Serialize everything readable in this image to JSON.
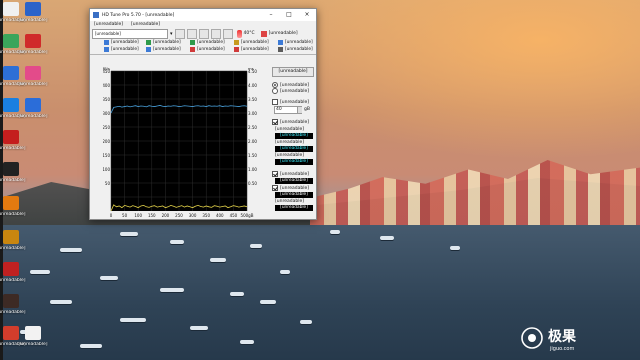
{
  "desktop": {
    "icons": [
      {
        "label": "[unreadable]",
        "color": "#f0f0f0"
      },
      {
        "label": "[unreadable]",
        "color": "#2b63c9"
      },
      {
        "label": "[unreadable]",
        "color": "#3aa55b"
      },
      {
        "label": "[unreadable]",
        "color": "#d02a2a"
      },
      {
        "label": "[unreadable]",
        "color": "#2d6fd6"
      },
      {
        "label": "[unreadable]",
        "color": "#e34b8a"
      },
      {
        "label": "[unreadable]",
        "color": "#1a7fe0"
      },
      {
        "label": "[unreadable]",
        "color": "#2b6dd9"
      },
      {
        "label": "[unreadable]",
        "color": "#c41e1e"
      },
      {
        "label": "[unreadable]",
        "color": "#222222"
      },
      {
        "label": "[unreadable]",
        "color": "#e37a10"
      },
      {
        "label": "[unreadable]",
        "color": "#c8860f"
      },
      {
        "label": "[unreadable]",
        "color": "#c02121"
      },
      {
        "label": "[unreadable]",
        "color": "#3d2a24"
      },
      {
        "label": "[unreadable]",
        "color": "#d33d2c"
      },
      {
        "label": "[unreadable]",
        "color": "#f2f2f2"
      },
      {
        "label": "[unreadable]",
        "color": "#e8a020"
      },
      {
        "label": "[unreadable]",
        "color": "#c9c9c9"
      }
    ],
    "watermark": {
      "main": "极果",
      "sub": "jiguo.com"
    }
  },
  "window": {
    "title": "HD Tune Pro 5.70 - [unreadable]",
    "menu": [
      "[unreadable]",
      "[unreadable]"
    ],
    "drive": "[unreadable]",
    "temperature": "40°C",
    "exit_label": "[unreadable]",
    "tabs": [
      {
        "label": "[unreadable]",
        "color": "#3c7ad6"
      },
      {
        "label": "[unreadable]",
        "color": "#2e9a4a"
      },
      {
        "label": "[unreadable]",
        "color": "#2e9a4a"
      },
      {
        "label": "[unreadable]",
        "color": "#c79a1e"
      },
      {
        "label": "[unreadable]",
        "color": "#3c7ad6"
      },
      {
        "label": "[unreadable]",
        "color": "#3c7ad6"
      },
      {
        "label": "[unreadable]",
        "color": "#3c7ad6"
      },
      {
        "label": "[unreadable]",
        "color": "#d03a3a"
      },
      {
        "label": "[unreadable]",
        "color": "#d03a3a"
      },
      {
        "label": "[unreadable]",
        "color": "#5b5b5b"
      }
    ],
    "panel": {
      "start_label": "[unreadable]",
      "read_label": "[unreadable]",
      "write_label": "[unreadable]",
      "short_stroke_label": "[unreadable]",
      "short_stroke_value": "40",
      "short_stroke_unit": "gB",
      "transfer_rate_label": "[unreadable]",
      "min_label": "[unreadable]",
      "min_value": "[unreadable]",
      "max_label": "[unreadable]",
      "max_value": "[unreadable]",
      "avg_label": "[unreadable]",
      "avg_value": "[unreadable]",
      "access_time_label": "[unreadable]",
      "access_time_value": "[unreadable]",
      "burst_rate_label": "[unreadable]",
      "burst_rate_value": "[unreadable]",
      "cpu_label": "[unreadable]",
      "cpu_value": "[unreadable]"
    }
  },
  "chart_data": {
    "type": "line",
    "ylabel_left": "MB/s",
    "ylabel_right": "ms",
    "y_left_ticks": [
      "450",
      "400",
      "350",
      "300",
      "250",
      "200",
      "150",
      "100",
      "50",
      ""
    ],
    "y_right_ticks": [
      "4.50",
      "4.00",
      "3.50",
      "3.00",
      "2.50",
      "2.00",
      "1.50",
      "1.00",
      "0.50",
      ""
    ],
    "x_ticks": [
      "0",
      "50",
      "100",
      "150",
      "200",
      "250",
      "300",
      "350",
      "400",
      "450",
      "500gB"
    ],
    "ylim": [
      0,
      500
    ],
    "series": [
      {
        "values": [
          350,
          370,
          372,
          374,
          371,
          373,
          375,
          372,
          374,
          376,
          373,
          375,
          374,
          372,
          376,
          374,
          373,
          375,
          377,
          374,
          373,
          375,
          374,
          376,
          375,
          373,
          374,
          376,
          375,
          374,
          373,
          375,
          376,
          374,
          375,
          373,
          376,
          374,
          375,
          374,
          376,
          373,
          375,
          374,
          376,
          375,
          374,
          373,
          375,
          376,
          374
        ],
        "color": "#4aa3df"
      },
      {
        "values": [
          0,
          22,
          15,
          18,
          12,
          20,
          17,
          14,
          19,
          16,
          12,
          18,
          20,
          15,
          13,
          17,
          19,
          14,
          16,
          18,
          12,
          15,
          20,
          17,
          13,
          16,
          19,
          14,
          18,
          15,
          12,
          17,
          20,
          16,
          14,
          18,
          15,
          13,
          19,
          17,
          14,
          16,
          18,
          12,
          15,
          19,
          17,
          14,
          16,
          18,
          15
        ],
        "color": "#e6d54a"
      }
    ],
    "grid": true
  }
}
